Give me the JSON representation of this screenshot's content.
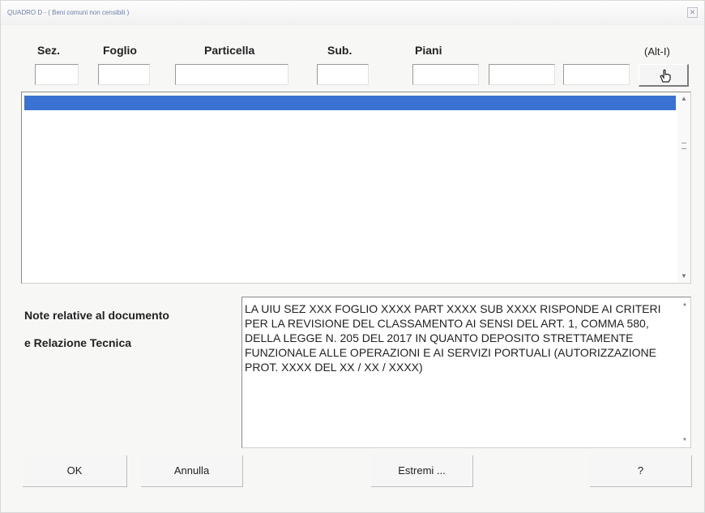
{
  "window": {
    "title": "QUADRO D - ( Beni comuni non censibili )"
  },
  "headers": {
    "sez": "Sez.",
    "foglio": "Foglio",
    "particella": "Particella",
    "sub": "Sub.",
    "piani": "Piani",
    "shortcut": "(Alt-I)"
  },
  "fields": {
    "sez": "",
    "foglio": "",
    "particella": "",
    "sub": "",
    "piano_1": "",
    "piano_2": "",
    "piano_3": ""
  },
  "icons": {
    "insert": "hand-pointer-icon",
    "scroll_up": "scroll-up-arrow-icon",
    "scroll_down": "scroll-down-arrow-icon"
  },
  "notes": {
    "label_line1": "Note relative al documento",
    "label_line2": "e Relazione Tecnica",
    "text": "LA UIU SEZ xxx FOGLIO xxxx PART xxxx SUB xxxx RISPONDE AI CRITERI PER LA REVISIONE DEL CLASSAMENTO AI SENSI DEL ART. 1, COMMA 580, DELLA LEGGE N. 205 DEL 2017 IN QUANTO DEPOSITO STRETTAMENTE FUNZIONALE ALLE OPERAZIONI E AI SERVIZI PORTUALI (AUTORIZZAZIONE PROT. xxxx DEL xx / xx / xxxx)"
  },
  "buttons": {
    "ok": "OK",
    "annulla": "Annulla",
    "estremi": "Estremi ...",
    "help": "?"
  },
  "colors": {
    "selection": "#3a72d3",
    "title_text": "#6d7fa8"
  }
}
